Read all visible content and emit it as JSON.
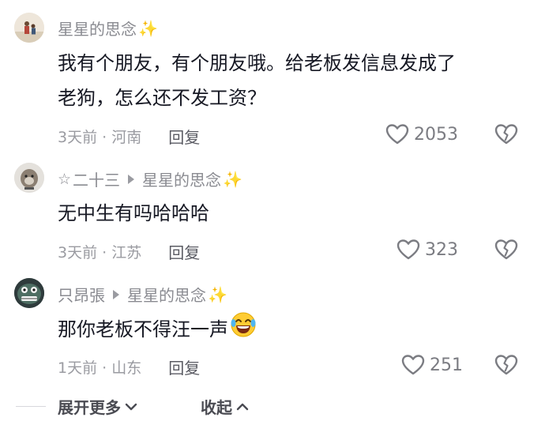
{
  "comments": [
    {
      "username": "星星的思念",
      "sparkle": "✨",
      "text_line1": "我有个朋友，有个朋友哦。给老板发信息发成了",
      "text_line2": "老狗，怎么还不发工资？",
      "time_location": "3天前 · 河南",
      "reply_label": "回复",
      "likes": "2053"
    },
    {
      "username_prefix": "☆",
      "username": "二十三",
      "reply_to": "星星的思念",
      "sparkle": "✨",
      "text": "无中生有吗哈哈哈",
      "time_location": "3天前 · 江苏",
      "reply_label": "回复",
      "likes": "323"
    },
    {
      "username": "只昂張",
      "reply_to": "星星的思念",
      "sparkle": "✨",
      "text": "那你老板不得汪一声",
      "time_location": "1天前 · 山东",
      "reply_label": "回复",
      "likes": "251"
    }
  ],
  "footer": {
    "show_more": "展开更多",
    "collapse": "收起"
  },
  "icons": {
    "like": "heart-outline-icon",
    "dislike": "broken-heart-icon",
    "emoji": "laughing-crying-emoji"
  }
}
